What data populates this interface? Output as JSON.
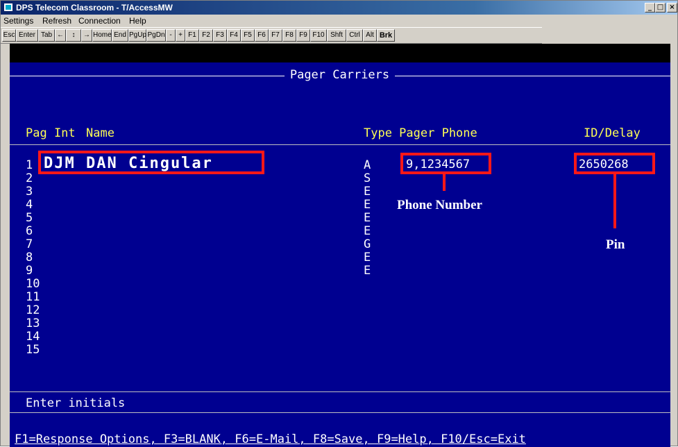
{
  "window": {
    "title": "DPS Telecom Classroom - T/AccessMW",
    "controls": [
      "minimize",
      "maximize",
      "close"
    ]
  },
  "menu": [
    "Settings",
    "Refresh",
    "Connection",
    "Help"
  ],
  "toolbar": {
    "keys": [
      "Esc",
      "Enter",
      "Tab",
      "←",
      "↕",
      "→",
      "Home",
      "End",
      "PgUp",
      "PgDn",
      "-",
      "+",
      "F1",
      "F2",
      "F3",
      "F4",
      "F5",
      "F6",
      "F7",
      "F8",
      "F9",
      "F10",
      "Shft",
      "Ctrl",
      "Alt",
      "Brk"
    ]
  },
  "screen": {
    "title": "Pager Carriers",
    "headers": {
      "pag_int": "Pag Int",
      "name": "Name",
      "type_pager_phone": "Type Pager Phone",
      "id_delay": "ID/Delay"
    },
    "row_numbers": [
      "1",
      "2",
      "3",
      "4",
      "5",
      "6",
      "7",
      "8",
      "9",
      "10",
      "11",
      "12",
      "13",
      "14",
      "15"
    ],
    "types": [
      "A",
      "S",
      "E",
      "E",
      "E",
      "E",
      "G",
      "E",
      "E"
    ],
    "entry": {
      "name": "DJM DAN Cingular",
      "phone": "9,1234567",
      "id": "2650268"
    },
    "status": "Enter initials",
    "function_keys": "F1=Response Options, F3=BLANK, F6=E-Mail, F8=Save, F9=Help, F10/Esc=Exit"
  },
  "annotations": {
    "phone": "Phone Number",
    "pin": "Pin",
    "color": "#ff1818"
  },
  "colors": {
    "terminal_bg": "#000090",
    "header_text": "#ffff55"
  }
}
